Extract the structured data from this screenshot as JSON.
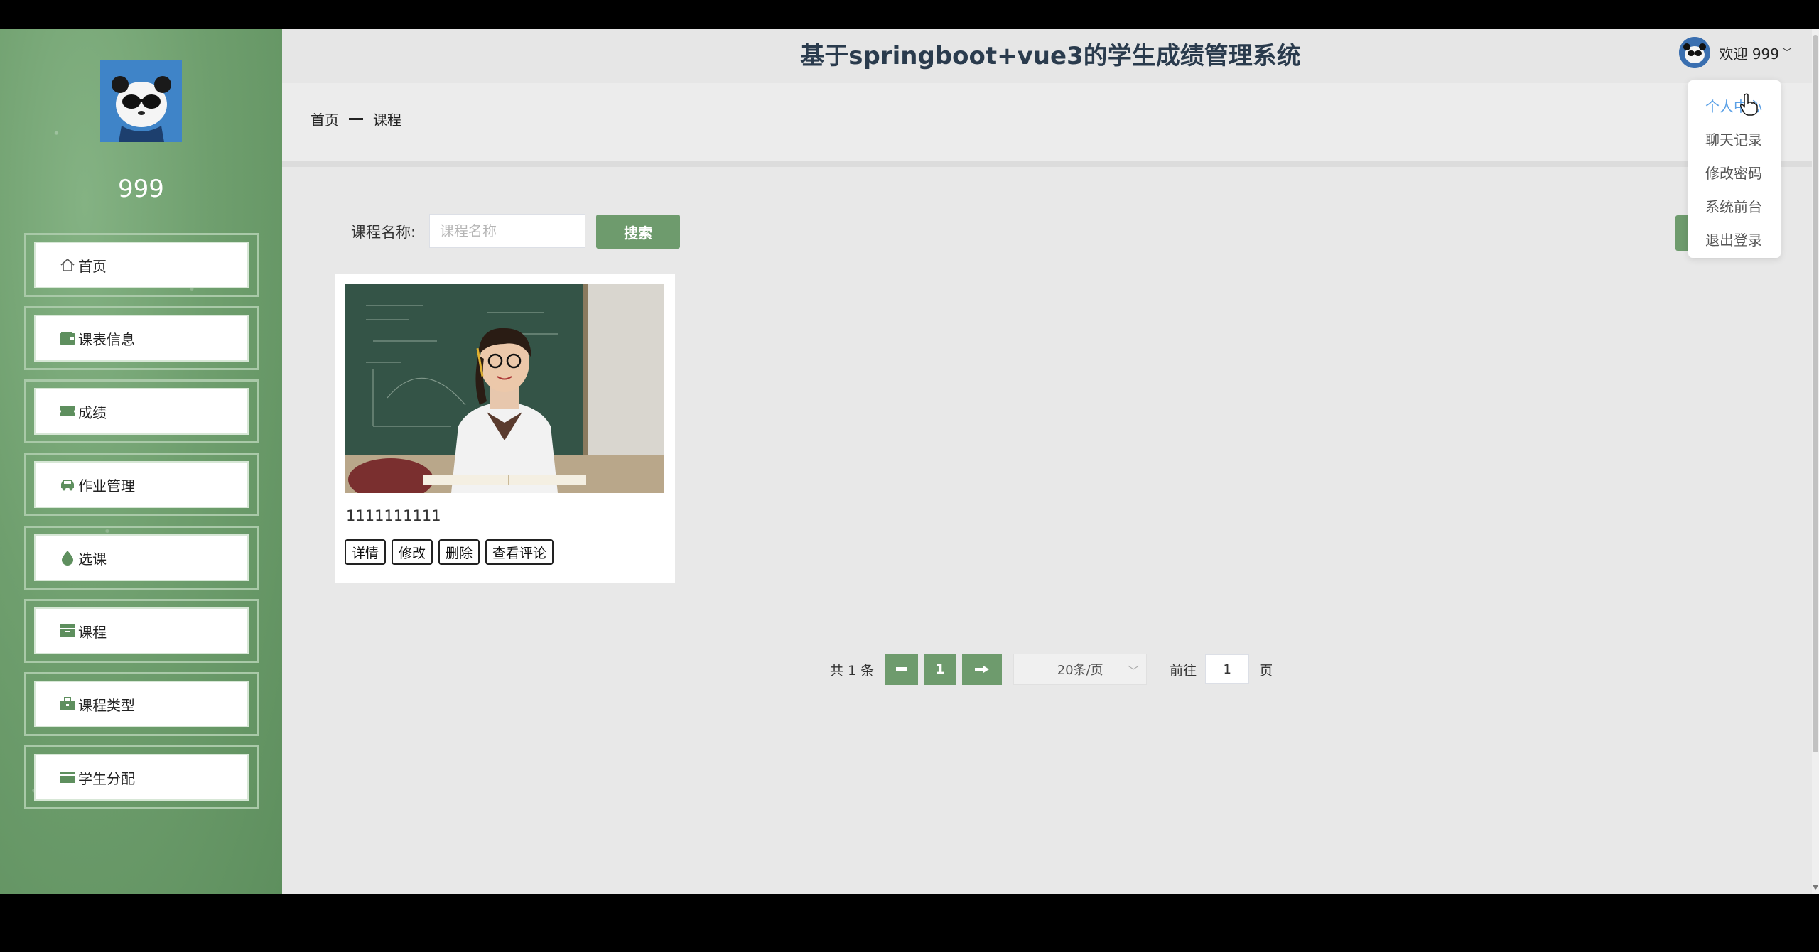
{
  "header": {
    "title": "基于springboot+vue3的学生成绩管理系统",
    "welcome": "欢迎 999"
  },
  "sidebar": {
    "username": "999",
    "items": [
      {
        "label": "首页",
        "icon": "home-icon"
      },
      {
        "label": "课表信息",
        "icon": "wallet-icon"
      },
      {
        "label": "成绩",
        "icon": "ticket-icon"
      },
      {
        "label": "作业管理",
        "icon": "car-icon"
      },
      {
        "label": "选课",
        "icon": "drop-icon"
      },
      {
        "label": "课程",
        "icon": "box-icon"
      },
      {
        "label": "课程类型",
        "icon": "briefcase-icon"
      },
      {
        "label": "学生分配",
        "icon": "card-icon"
      }
    ]
  },
  "breadcrumb": {
    "home": "首页",
    "current": "课程"
  },
  "search": {
    "label": "课程名称:",
    "placeholder": "课程名称",
    "button": "搜索"
  },
  "courses": [
    {
      "name": "1111111111",
      "actions": [
        "详情",
        "修改",
        "删除",
        "查看评论"
      ]
    }
  ],
  "pagination": {
    "total": "共 1 条",
    "page": "1",
    "page_size": "20条/页",
    "goto_label": "前往",
    "goto_value": "1",
    "page_suffix": "页"
  },
  "dropdown": {
    "items": [
      "个人中心",
      "聊天记录",
      "修改密码",
      "系统前台",
      "退出登录"
    ],
    "active_index": 0
  },
  "colors": {
    "sidebar": "#6f9f6e",
    "accent": "#6e9b6d",
    "title": "#2a3b4d",
    "dropdown_active": "#5aa0e6"
  }
}
